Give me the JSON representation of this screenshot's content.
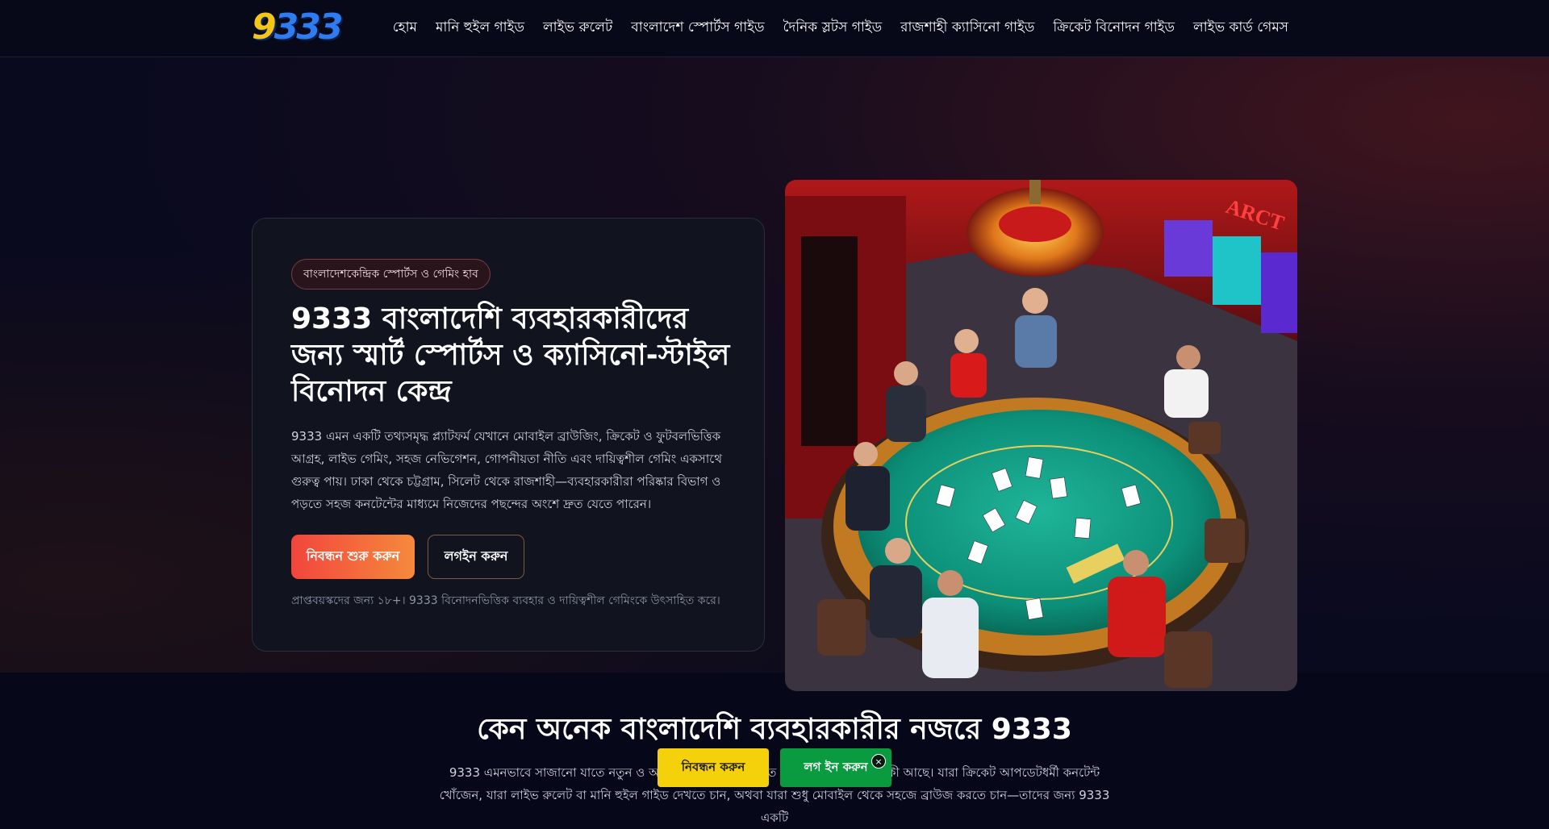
{
  "header": {
    "logo_text": "9333",
    "nav": [
      "হোম",
      "মানি হুইল গাইড",
      "লাইভ রুলেট",
      "বাংলাদেশ স্পোর্টস গাইড",
      "দৈনিক স্লটস গাইড",
      "রাজশাহী ক্যাসিনো গাইড",
      "ক্রিকেট বিনোদন গাইড",
      "লাইভ কার্ড গেমস"
    ]
  },
  "hero": {
    "badge": "বাংলাদেশকেন্দ্রিক স্পোর্টস ও গেমিং হাব",
    "title": "9333 বাংলাদেশি ব্যবহারকারীদের জন্য স্মার্ট স্পোর্টস ও ক্যাসিনো-স্টাইল বিনোদন কেন্দ্র",
    "description": "9333 এমন একটি তথ্যসমৃদ্ধ প্ল্যাটফর্ম যেখানে মোবাইল ব্রাউজিং, ক্রিকেট ও ফুটবলভিত্তিক আগ্রহ, লাইভ গেমিং, সহজ নেভিগেশন, গোপনীয়তা নীতি এবং দায়িত্বশীল গেমিং একসাথে গুরুত্ব পায়। ঢাকা থেকে চট্টগ্রাম, সিলেট থেকে রাজশাহী—ব্যবহারকারীরা পরিষ্কার বিভাগ ও পড়তে সহজ কনটেন্টের মাধ্যমে নিজেদের পছন্দের অংশে দ্রুত যেতে পারেন।",
    "primary_button": "নিবন্ধন শুরু করুন",
    "secondary_button": "লগইন করুন",
    "disclaimer": "প্রাপ্তবয়স্কদের জন্য ১৮+। 9333 বিনোদনভিত্তিক ব্যবহার ও দায়িত্বশীল গেমিংকে উৎসাহিত করে।"
  },
  "section": {
    "title": "কেন অনেক বাংলাদেশি ব্যবহারকারীর নজরে 9333",
    "text": "9333 এমনভাবে সাজানো যাতে নতুন ও অভিজ্ঞ ব্যবহারকারীরা দ্রুত বুঝতে পারেন কোথায় কী আছে। যারা ক্রিকেট আপডেটধর্মী কনটেন্ট খোঁজেন, যারা লাইভ রুলেট বা মানি হুইল গাইড দেখতে চান, অথবা যারা শুধু মোবাইল থেকে সহজে ব্রাউজ করতে চান—তাদের জন্য 9333 একটি"
  },
  "sticky": {
    "register": "নিবন্ধন করুন",
    "login": "লগ ইন করুন",
    "close": "×"
  },
  "colors": {
    "primary_gradient_start": "#f2453d",
    "primary_gradient_end": "#f58a3c",
    "sticky_register": "#f5d10c",
    "sticky_login": "#0a9a3f",
    "background": "#07071a"
  }
}
